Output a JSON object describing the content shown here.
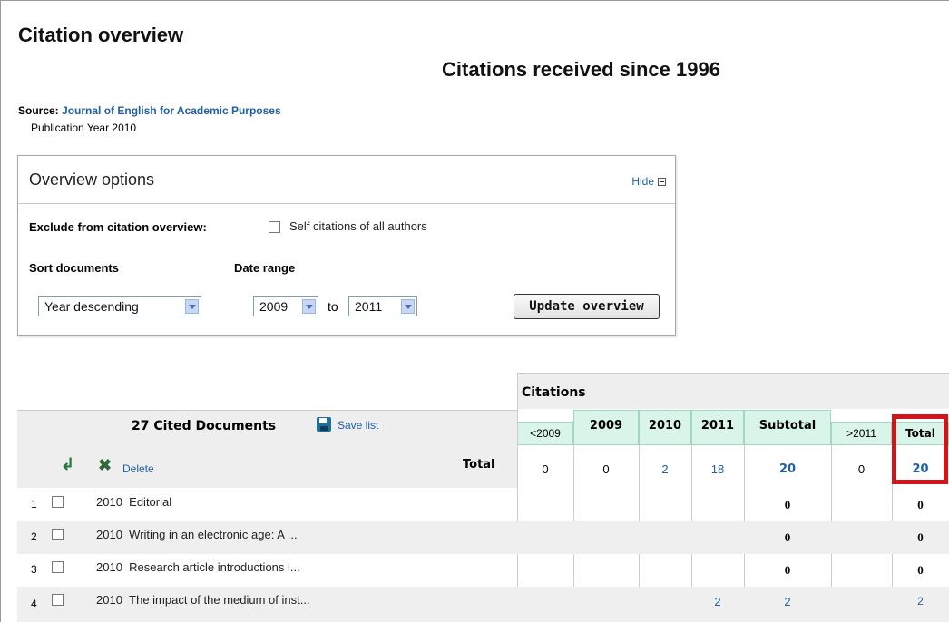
{
  "header": {
    "title": "Citation overview",
    "subtitle": "Citations received since 1996"
  },
  "source": {
    "label": "Source:",
    "journal": "Journal of English for Academic Purposes",
    "publication_year": "Publication Year 2010"
  },
  "options": {
    "title": "Overview options",
    "hide_label": "Hide",
    "exclude_label": "Exclude from citation overview:",
    "self_citations_label": "Self citations of all authors",
    "sort_label": "Sort documents",
    "date_range_label": "Date range",
    "sort_value": "Year descending",
    "date_from": "2009",
    "to_label": "to",
    "date_to": "2011",
    "update_button": "Update overview"
  },
  "table": {
    "citations_label": "Citations",
    "cited_documents": "27 Cited Documents",
    "save_list": "Save list",
    "delete_label": "Delete",
    "total_label": "Total",
    "columns": [
      "<2009",
      "2009",
      "2010",
      "2011",
      "Subtotal",
      ">2011",
      "Total"
    ],
    "totals": [
      "0",
      "0",
      "2",
      "18",
      "20",
      "0",
      "20"
    ],
    "rows": [
      {
        "num": "1",
        "year": "2010",
        "title": "Editorial",
        "v2010": "",
        "v2011": "",
        "subtotal": "0",
        "total": "0"
      },
      {
        "num": "2",
        "year": "2010",
        "title": "Writing in an electronic age: A ...",
        "v2010": "",
        "v2011": "",
        "subtotal": "0",
        "total": "0"
      },
      {
        "num": "3",
        "year": "2010",
        "title": "Research article introductions i...",
        "v2010": "",
        "v2011": "",
        "subtotal": "0",
        "total": "0"
      },
      {
        "num": "4",
        "year": "2010",
        "title": "The impact of the medium of inst...",
        "v2010": "",
        "v2011": "2",
        "subtotal": "2",
        "total": "2"
      }
    ]
  },
  "colors": {
    "link": "#1f5fa6",
    "highlight": "#d0151b",
    "year_header_bg": "#d9f4e8"
  }
}
